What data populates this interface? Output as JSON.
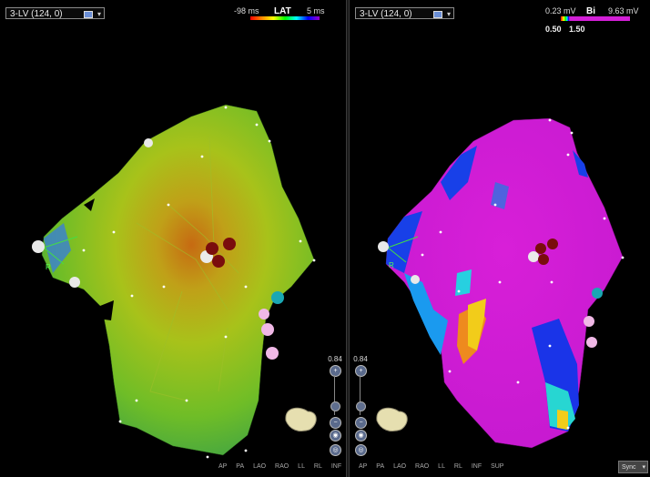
{
  "left_view": {
    "map_name": "3-LV (124, 0)",
    "scale_min": "-98 ms",
    "scale_title": "LAT",
    "scale_max": "5 ms",
    "zoom_value": "0.84"
  },
  "right_view": {
    "map_name": "3-LV (124, 0)",
    "scale_min": "0.23 mV",
    "scale_title": "Bi",
    "scale_max": "9.63 mV",
    "threshold_low": "0.50",
    "threshold_high": "1.50",
    "zoom_value": "0.84"
  },
  "orientation_marker": "R",
  "view_buttons": [
    "AP",
    "PA",
    "LAO",
    "RAO",
    "LL",
    "RL",
    "INF",
    "SUP"
  ],
  "sync_label": "Sync",
  "colors": {
    "lat_map_primary": "#7fc421",
    "voltage_map_primary": "#d21fd6",
    "catheter_tip": "#7a0d0d",
    "tag_pink": "#f0b8e6",
    "tag_cyan": "#1aa7b3"
  }
}
